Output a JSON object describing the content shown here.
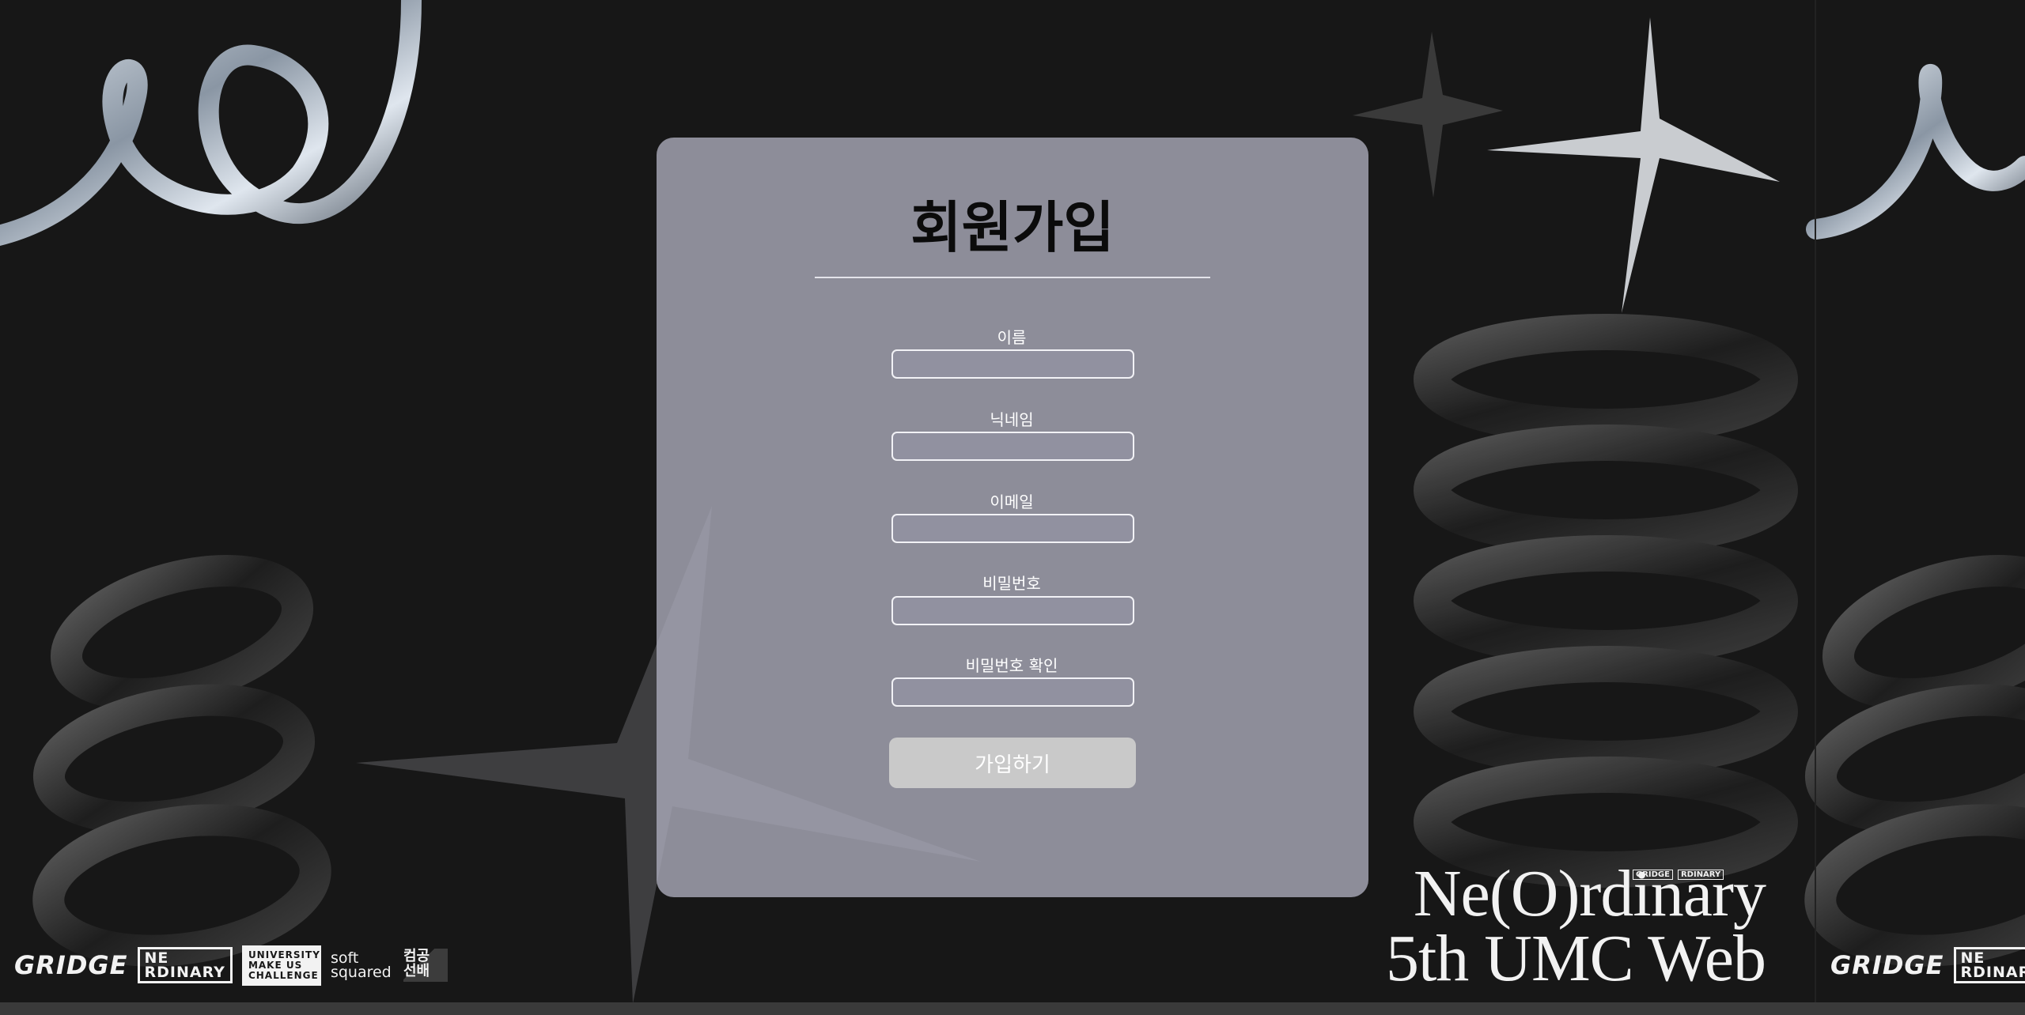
{
  "page": {
    "heading": "회원가입",
    "submit_label": "가입하기"
  },
  "fields": [
    {
      "label": "이름",
      "value": ""
    },
    {
      "label": "닉네임",
      "value": ""
    },
    {
      "label": "이메일",
      "value": ""
    },
    {
      "label": "비밀번호",
      "value": ""
    },
    {
      "label": "비밀번호 확인",
      "value": ""
    }
  ],
  "branding": {
    "event_line1": "Ne(O)rdinary",
    "event_line2": "5th UMC Web",
    "logo_gridge": "GRIDGE",
    "logo_neo_top": "NE",
    "logo_neo_bottom": "RDINARY",
    "logo_umc": "UNIVERSITY MAKE US CHALLENGE",
    "logo_soft": "soft squared",
    "logo_kr": "컴공 선배"
  },
  "colors": {
    "background": "#171717",
    "card": "#ababba",
    "button": "#c9c9c9"
  }
}
